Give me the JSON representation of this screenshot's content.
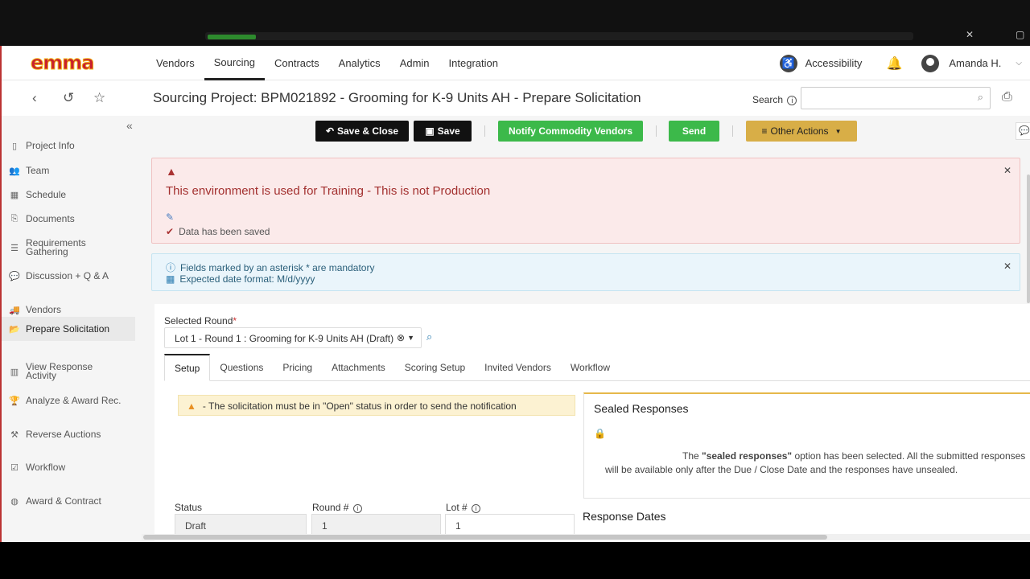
{
  "nav": {
    "logo": "emma",
    "items": [
      "Vendors",
      "Sourcing",
      "Contracts",
      "Analytics",
      "Admin",
      "Integration"
    ],
    "accessibility": "Accessibility",
    "user": "Amanda H."
  },
  "header": {
    "title": "Sourcing Project: BPM021892 - Grooming for K-9 Units AH - Prepare Solicitation",
    "search_label": "Search",
    "search_value": ""
  },
  "sidebar": {
    "items": [
      {
        "label": "Project Info",
        "icon": "file-icon"
      },
      {
        "label": "Team",
        "icon": "users-icon"
      },
      {
        "label": "Schedule",
        "icon": "calendar-icon"
      },
      {
        "label": "Documents",
        "icon": "document-icon"
      },
      {
        "label": "Requirements Gathering",
        "icon": "list-icon"
      },
      {
        "label": "Discussion + Q & A",
        "icon": "comments-icon"
      },
      {
        "label": "Vendors",
        "icon": "truck-icon"
      },
      {
        "label": "Prepare Solicitation",
        "icon": "folder-open-icon"
      },
      {
        "label": "View Response Activity",
        "icon": "chart-icon"
      },
      {
        "label": "Analyze & Award Rec.",
        "icon": "trophy-icon"
      },
      {
        "label": "Reverse Auctions",
        "icon": "gavel-icon"
      },
      {
        "label": "Workflow",
        "icon": "checkbox-icon"
      },
      {
        "label": "Award & Contract",
        "icon": "palette-icon"
      }
    ]
  },
  "toolbar": {
    "save_close": "Save & Close",
    "save": "Save",
    "notify": "Notify Commodity Vendors",
    "send": "Send",
    "other": "Other Actions"
  },
  "alerts": {
    "training": "This environment is used for Training - This is not Production",
    "saved": "Data has been saved",
    "mandatory": "Fields marked by an asterisk * are mandatory",
    "date_format": "Expected date format: M/d/yyyy"
  },
  "form": {
    "selected_round_label": "Selected Round",
    "selected_round_value": "Lot 1 - Round 1 : Grooming for K-9 Units AH (Draft)",
    "tabs": [
      "Setup",
      "Questions",
      "Pricing",
      "Attachments",
      "Scoring Setup",
      "Invited Vendors",
      "Workflow"
    ],
    "notice": "- The solicitation must be in \"Open\" status in order to send the notification",
    "sealed_title": "Sealed Responses",
    "sealed_pre": "The ",
    "sealed_bold": "\"sealed responses\"",
    "sealed_post": " option has been selected. All the submitted responses will be available only after the Due / Close Date and the responses have unsealed.",
    "response_dates": "Response Dates",
    "status_label": "Status",
    "status_value": "Draft",
    "round_label": "Round #",
    "round_value": "1",
    "lot_label": "Lot #",
    "lot_value": "1"
  },
  "colors": {
    "accent_green": "#3cb94a",
    "accent_yellow": "#d8ae47",
    "danger_text": "#a3302f"
  }
}
